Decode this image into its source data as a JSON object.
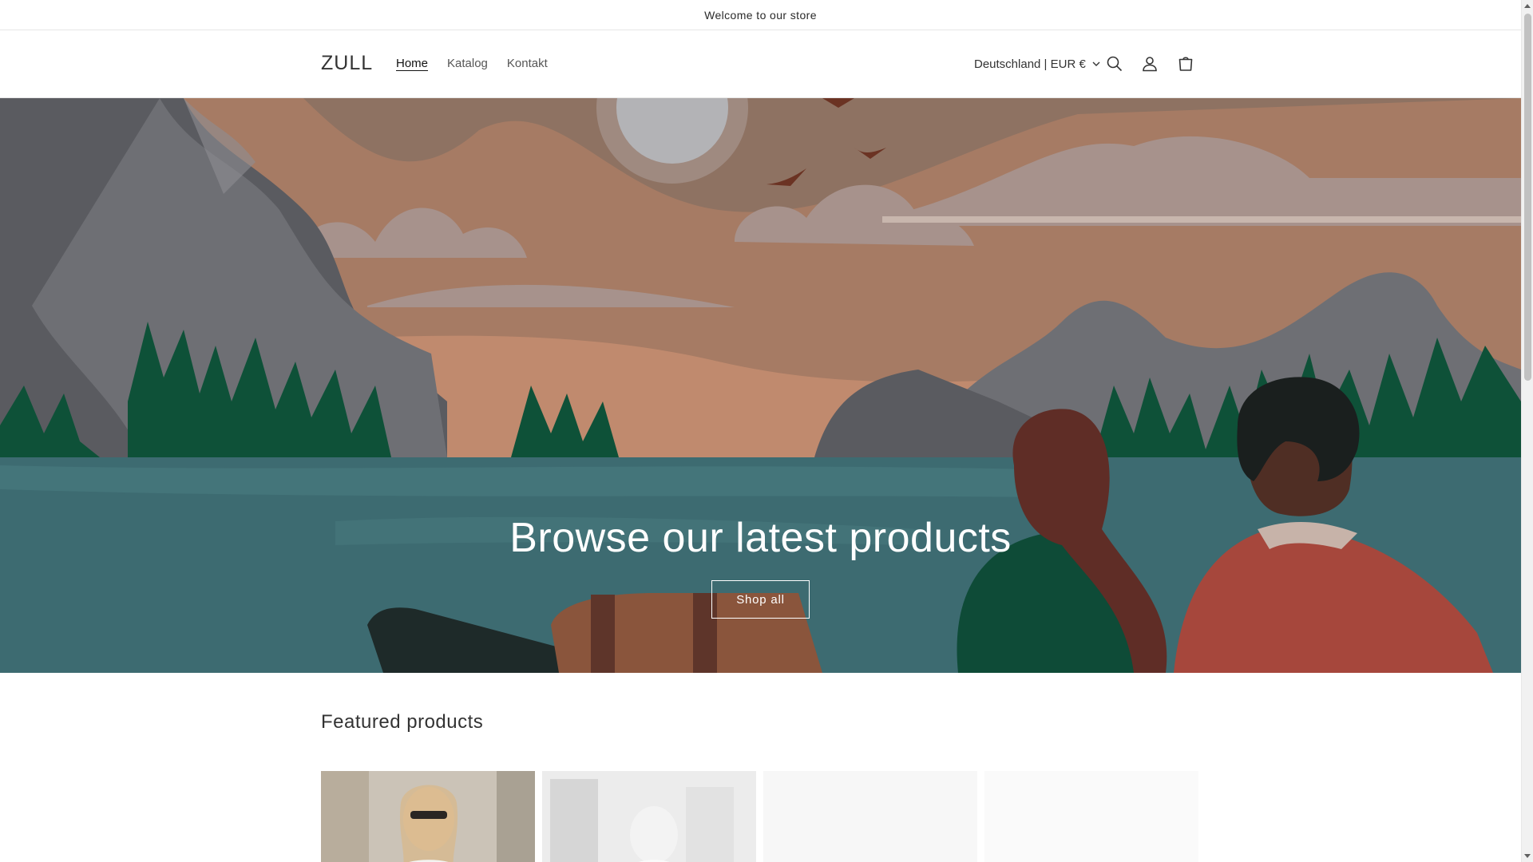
{
  "announcement": {
    "text": "Welcome to our store"
  },
  "header": {
    "logo": "ZULL",
    "nav": [
      {
        "label": "Home",
        "active": true
      },
      {
        "label": "Katalog",
        "active": false
      },
      {
        "label": "Kontakt",
        "active": false
      }
    ],
    "country_selector": "Deutschland | EUR €",
    "icons": [
      "search-icon",
      "account-icon",
      "cart-icon"
    ]
  },
  "hero": {
    "title": "Browse our latest products",
    "button_label": "Shop all",
    "colors": {
      "sky": "#8e7262",
      "lake": "#3d6b71",
      "trees": "#0e5138",
      "mountain": "#6a6b70"
    }
  },
  "featured": {
    "title": "Featured products"
  }
}
